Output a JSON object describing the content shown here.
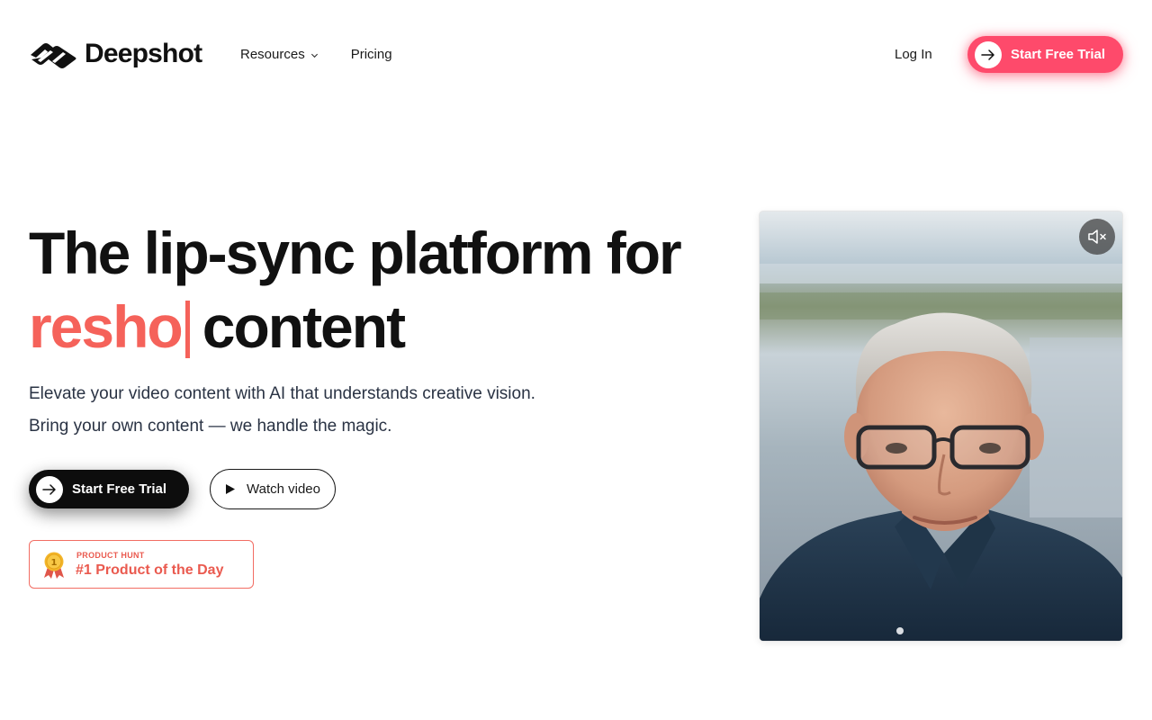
{
  "brand": {
    "name": "Deepshot"
  },
  "nav": {
    "items": [
      {
        "label": "Resources",
        "has_dropdown": true
      },
      {
        "label": "Pricing",
        "has_dropdown": false
      }
    ],
    "login_label": "Log In",
    "cta_label": "Start Free Trial"
  },
  "hero": {
    "title_line1": "The lip-sync platform for",
    "typed_word": "resho",
    "title_line2_suffix": "content",
    "subtitle_line1": "Elevate your video content with AI that understands creative vision.",
    "subtitle_line2": "Bring your own content — we handle the magic.",
    "primary_cta": "Start Free Trial",
    "secondary_cta": "Watch video"
  },
  "badge": {
    "kicker": "PRODUCT HUNT",
    "title": "#1 Product of the Day",
    "medal_rank": "1"
  },
  "video": {
    "muted": true,
    "mute_icon": "speaker-muted-icon"
  },
  "colors": {
    "accent": "#fe4a6b",
    "typed": "#f5625a",
    "badge": "#ea5a4f",
    "dark": "#0d0d0d"
  }
}
